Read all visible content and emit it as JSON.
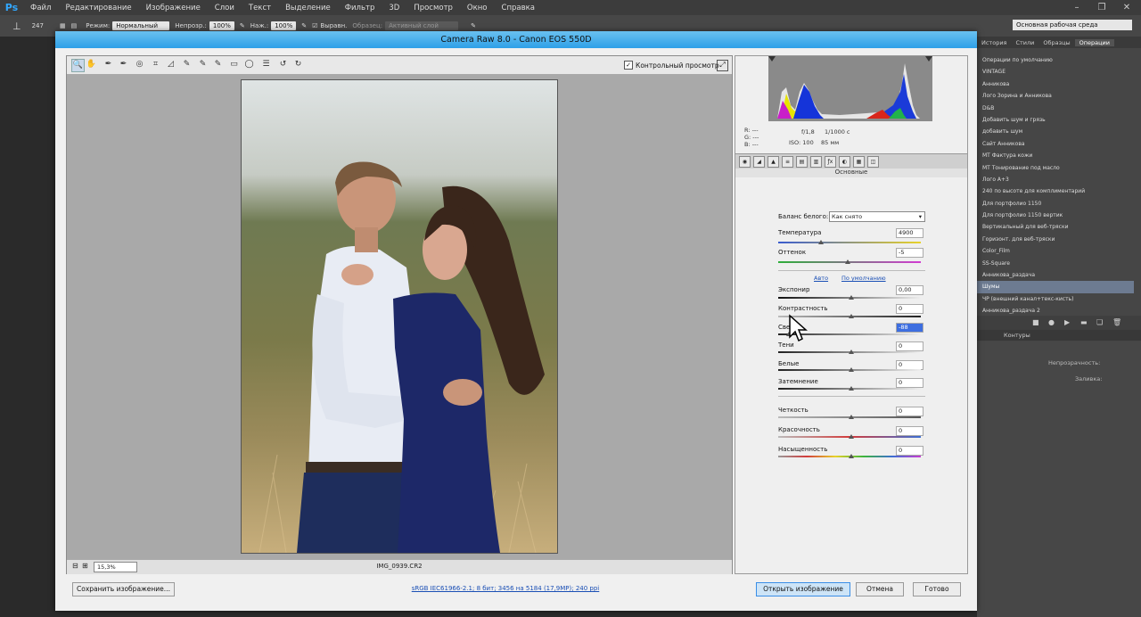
{
  "ps": {
    "logo": "Ps",
    "menu": [
      "Файл",
      "Редактирование",
      "Изображение",
      "Слои",
      "Текст",
      "Выделение",
      "Фильтр",
      "3D",
      "Просмотр",
      "Окно",
      "Справка"
    ],
    "options": {
      "brush_size": "247",
      "mode_label": "Режим:",
      "mode_value": "Нормальный",
      "opacity_label": "Непрозр.:",
      "opacity_value": "100%",
      "flow_label": "Наж.:",
      "flow_value": "100%",
      "align_label": "Выравн.",
      "sample_label": "Образец:",
      "sample_value": "Активный слой",
      "workspace": "Основная рабочая среда"
    },
    "panel_tabs": [
      "История",
      "Стили",
      "Образцы",
      "Операции"
    ],
    "active_panel_tab": "Операции",
    "actions": [
      "Операции по умолчанию",
      "VINTAGE",
      "Анникова",
      "Лого Зорина и Анникова",
      "D&B",
      "Добавить шум и грязь",
      "добавить шум",
      "Сайт Анникова",
      "MT Фактура кожи",
      "MT Тонирование под масло",
      "Лого A+3",
      "240 по высоте для комплиментарий",
      "Для портфолио 1150",
      "Для портфолио 1150 вертик",
      "Вертикальный для веб-тряски",
      "Горизонт. для веб-тряски",
      "Color_Film",
      "SS-Square",
      "Анникова_раздача",
      "Шумы",
      "ЧР (внешний канал+текс-кисть)",
      "Анникова_раздача 2"
    ],
    "selected_action": "Шумы",
    "layers_tab": "Контуры",
    "layers_opacity_label": "Непрозрачность:",
    "layers_fill_label": "Заливка:"
  },
  "dialog": {
    "title": "Camera Raw 8.0  -  Canon EOS 550D",
    "preview_checkbox": "Контрольный просмотр",
    "zoom": "15,3%",
    "filename": "IMG_0939.CR2",
    "rgb": {
      "r": "R:  ---",
      "g": "G:  ---",
      "b": "B:  ---"
    },
    "exif": {
      "aperture": "f/1,8",
      "shutter": "1/1000 с",
      "iso": "ISO: 100",
      "focal": "85 мм"
    },
    "panel_name": "Основные",
    "white_balance_label": "Баланс белого:",
    "white_balance_value": "Как снято",
    "temperature": {
      "label": "Температура",
      "value": "4900"
    },
    "tint": {
      "label": "Оттенок",
      "value": "-5"
    },
    "auto_link": "Авто",
    "default_link": "По умолчанию",
    "exposure": {
      "label": "Экспонир",
      "value": "0,00"
    },
    "contrast": {
      "label": "Контрастность",
      "value": "0"
    },
    "highlights": {
      "label": "Света",
      "value": "-88"
    },
    "shadows": {
      "label": "Тени",
      "value": "0"
    },
    "whites": {
      "label": "Белые",
      "value": "0"
    },
    "blacks": {
      "label": "Затемнение",
      "value": "0"
    },
    "clarity": {
      "label": "Четкость",
      "value": "0"
    },
    "vibrance": {
      "label": "Красочность",
      "value": "0"
    },
    "saturation": {
      "label": "Насыщенность",
      "value": "0"
    },
    "save_button": "Сохранить изображение...",
    "workflow": "sRGB IEC61966-2.1; 8 бит; 3456 на 5184 (17,9МР); 240 ppi",
    "open_button": "Открыть изображение",
    "cancel_button": "Отмена",
    "done_button": "Готово"
  }
}
